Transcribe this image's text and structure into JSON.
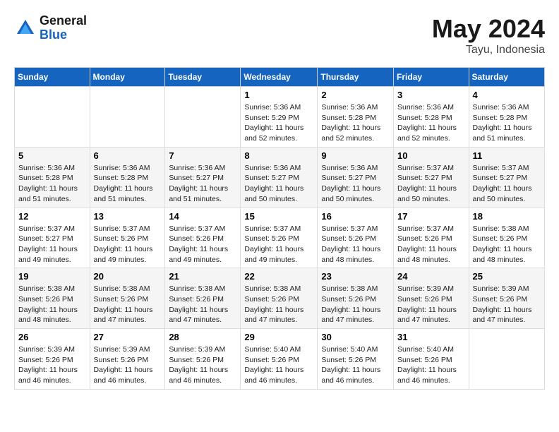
{
  "logo": {
    "general": "General",
    "blue": "Blue"
  },
  "title": {
    "month_year": "May 2024",
    "location": "Tayu, Indonesia"
  },
  "weekdays": [
    "Sunday",
    "Monday",
    "Tuesday",
    "Wednesday",
    "Thursday",
    "Friday",
    "Saturday"
  ],
  "weeks": [
    [
      {
        "day": "",
        "info": ""
      },
      {
        "day": "",
        "info": ""
      },
      {
        "day": "",
        "info": ""
      },
      {
        "day": "1",
        "info": "Sunrise: 5:36 AM\nSunset: 5:29 PM\nDaylight: 11 hours\nand 52 minutes."
      },
      {
        "day": "2",
        "info": "Sunrise: 5:36 AM\nSunset: 5:28 PM\nDaylight: 11 hours\nand 52 minutes."
      },
      {
        "day": "3",
        "info": "Sunrise: 5:36 AM\nSunset: 5:28 PM\nDaylight: 11 hours\nand 52 minutes."
      },
      {
        "day": "4",
        "info": "Sunrise: 5:36 AM\nSunset: 5:28 PM\nDaylight: 11 hours\nand 51 minutes."
      }
    ],
    [
      {
        "day": "5",
        "info": "Sunrise: 5:36 AM\nSunset: 5:28 PM\nDaylight: 11 hours\nand 51 minutes."
      },
      {
        "day": "6",
        "info": "Sunrise: 5:36 AM\nSunset: 5:28 PM\nDaylight: 11 hours\nand 51 minutes."
      },
      {
        "day": "7",
        "info": "Sunrise: 5:36 AM\nSunset: 5:27 PM\nDaylight: 11 hours\nand 51 minutes."
      },
      {
        "day": "8",
        "info": "Sunrise: 5:36 AM\nSunset: 5:27 PM\nDaylight: 11 hours\nand 50 minutes."
      },
      {
        "day": "9",
        "info": "Sunrise: 5:36 AM\nSunset: 5:27 PM\nDaylight: 11 hours\nand 50 minutes."
      },
      {
        "day": "10",
        "info": "Sunrise: 5:37 AM\nSunset: 5:27 PM\nDaylight: 11 hours\nand 50 minutes."
      },
      {
        "day": "11",
        "info": "Sunrise: 5:37 AM\nSunset: 5:27 PM\nDaylight: 11 hours\nand 50 minutes."
      }
    ],
    [
      {
        "day": "12",
        "info": "Sunrise: 5:37 AM\nSunset: 5:27 PM\nDaylight: 11 hours\nand 49 minutes."
      },
      {
        "day": "13",
        "info": "Sunrise: 5:37 AM\nSunset: 5:26 PM\nDaylight: 11 hours\nand 49 minutes."
      },
      {
        "day": "14",
        "info": "Sunrise: 5:37 AM\nSunset: 5:26 PM\nDaylight: 11 hours\nand 49 minutes."
      },
      {
        "day": "15",
        "info": "Sunrise: 5:37 AM\nSunset: 5:26 PM\nDaylight: 11 hours\nand 49 minutes."
      },
      {
        "day": "16",
        "info": "Sunrise: 5:37 AM\nSunset: 5:26 PM\nDaylight: 11 hours\nand 48 minutes."
      },
      {
        "day": "17",
        "info": "Sunrise: 5:37 AM\nSunset: 5:26 PM\nDaylight: 11 hours\nand 48 minutes."
      },
      {
        "day": "18",
        "info": "Sunrise: 5:38 AM\nSunset: 5:26 PM\nDaylight: 11 hours\nand 48 minutes."
      }
    ],
    [
      {
        "day": "19",
        "info": "Sunrise: 5:38 AM\nSunset: 5:26 PM\nDaylight: 11 hours\nand 48 minutes."
      },
      {
        "day": "20",
        "info": "Sunrise: 5:38 AM\nSunset: 5:26 PM\nDaylight: 11 hours\nand 47 minutes."
      },
      {
        "day": "21",
        "info": "Sunrise: 5:38 AM\nSunset: 5:26 PM\nDaylight: 11 hours\nand 47 minutes."
      },
      {
        "day": "22",
        "info": "Sunrise: 5:38 AM\nSunset: 5:26 PM\nDaylight: 11 hours\nand 47 minutes."
      },
      {
        "day": "23",
        "info": "Sunrise: 5:38 AM\nSunset: 5:26 PM\nDaylight: 11 hours\nand 47 minutes."
      },
      {
        "day": "24",
        "info": "Sunrise: 5:39 AM\nSunset: 5:26 PM\nDaylight: 11 hours\nand 47 minutes."
      },
      {
        "day": "25",
        "info": "Sunrise: 5:39 AM\nSunset: 5:26 PM\nDaylight: 11 hours\nand 47 minutes."
      }
    ],
    [
      {
        "day": "26",
        "info": "Sunrise: 5:39 AM\nSunset: 5:26 PM\nDaylight: 11 hours\nand 46 minutes."
      },
      {
        "day": "27",
        "info": "Sunrise: 5:39 AM\nSunset: 5:26 PM\nDaylight: 11 hours\nand 46 minutes."
      },
      {
        "day": "28",
        "info": "Sunrise: 5:39 AM\nSunset: 5:26 PM\nDaylight: 11 hours\nand 46 minutes."
      },
      {
        "day": "29",
        "info": "Sunrise: 5:40 AM\nSunset: 5:26 PM\nDaylight: 11 hours\nand 46 minutes."
      },
      {
        "day": "30",
        "info": "Sunrise: 5:40 AM\nSunset: 5:26 PM\nDaylight: 11 hours\nand 46 minutes."
      },
      {
        "day": "31",
        "info": "Sunrise: 5:40 AM\nSunset: 5:26 PM\nDaylight: 11 hours\nand 46 minutes."
      },
      {
        "day": "",
        "info": ""
      }
    ]
  ]
}
